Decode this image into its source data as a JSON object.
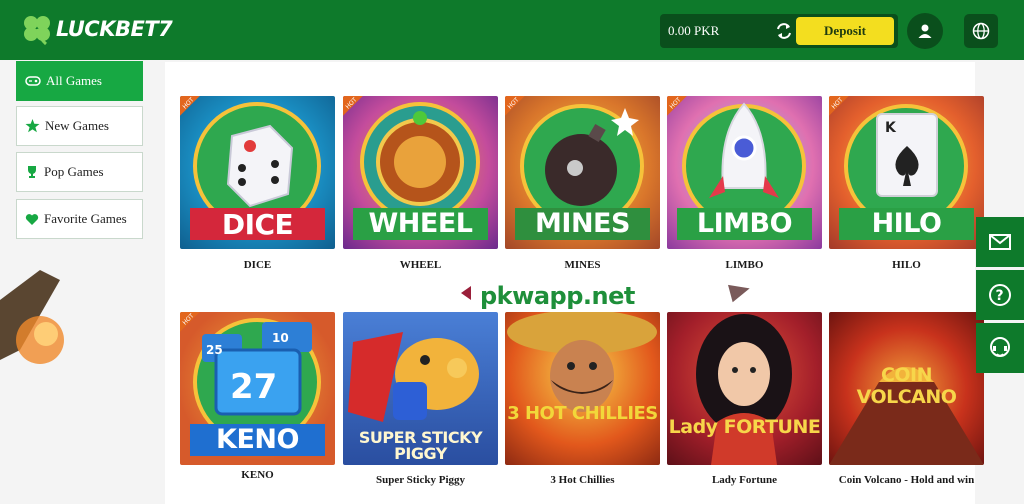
{
  "brand": {
    "logo_text": "LUCKBET7"
  },
  "wallet": {
    "balance": "0.00 PKR",
    "deposit_label": "Deposit"
  },
  "sidebar": {
    "items": [
      {
        "label": "All Games",
        "icon": "gamepad-icon",
        "active": true
      },
      {
        "label": "New Games",
        "icon": "star-icon"
      },
      {
        "label": "Pop Games",
        "icon": "trophy-icon"
      },
      {
        "label": "Favorite Games",
        "icon": "heart-icon"
      }
    ]
  },
  "games": [
    {
      "title": "DICE",
      "art_word": "DICE",
      "hot": true
    },
    {
      "title": "WHEEL",
      "art_word": "WHEEL",
      "hot": true
    },
    {
      "title": "MINES",
      "art_word": "MINES",
      "hot": true
    },
    {
      "title": "LIMBO",
      "art_word": "LIMBO",
      "hot": true
    },
    {
      "title": "HILO",
      "art_word": "HILO",
      "hot": true
    },
    {
      "title": "KENO",
      "art_word": "KENO",
      "hot": true
    },
    {
      "title": "Super Sticky Piggy",
      "art_word": "SUPER STICKY PIGGY"
    },
    {
      "title": "3 Hot Chillies",
      "art_word": "3 HOT CHILLIES"
    },
    {
      "title": "Lady Fortune",
      "art_word": "Lady FORTUNE"
    },
    {
      "title": "Coin Volcano - Hold and win",
      "art_word": "COIN VOLCANO"
    }
  ],
  "hot_badge": "HOT",
  "watermark": "pkwapp.net",
  "colors": {
    "brand_green": "#0e7a2b",
    "active_green": "#17a843",
    "deposit_yellow": "#f3de1f"
  },
  "float_buttons": [
    "mail-icon",
    "help-icon",
    "chat-support-icon"
  ]
}
